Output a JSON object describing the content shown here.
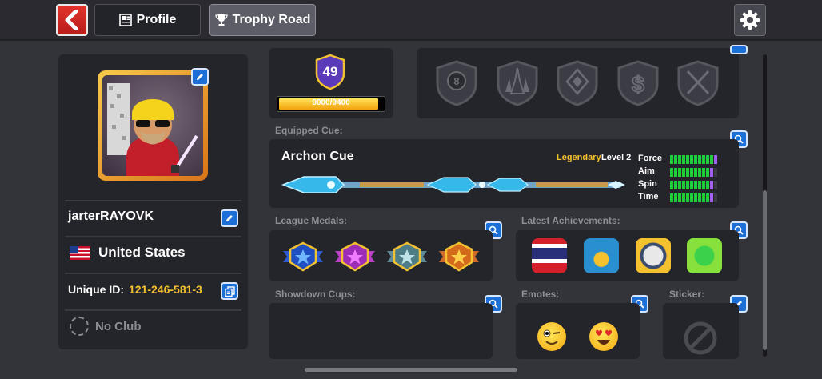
{
  "header": {
    "tabs": [
      {
        "label": "Profile"
      },
      {
        "label": "Trophy Road"
      }
    ]
  },
  "profile": {
    "username": "jarterRAYOVK",
    "country": "United States",
    "unique_id_label": "Unique ID:",
    "unique_id": "121-246-581-3",
    "club": "No Club"
  },
  "level": {
    "value": "49",
    "xp_text": "9000/9400",
    "xp_fraction": 0.957
  },
  "trophy_badges": [
    "8-ball-shield-icon",
    "tower-shield-icon",
    "diamond-shield-icon",
    "dollar-shield-icon",
    "swords-shield-icon"
  ],
  "equipped_cue": {
    "section_label": "Equipped Cue:",
    "name": "Archon Cue",
    "rarity": "Legendary",
    "level": "Level 2",
    "stats": [
      {
        "label": "Force",
        "filled": 11,
        "purple": 1,
        "empty": 0
      },
      {
        "label": "Aim",
        "filled": 10,
        "purple": 1,
        "empty": 1
      },
      {
        "label": "Spin",
        "filled": 10,
        "purple": 1,
        "empty": 1
      },
      {
        "label": "Time",
        "filled": 10,
        "purple": 1,
        "empty": 1
      }
    ]
  },
  "sections": {
    "league_medals": "League Medals:",
    "latest_achievements": "Latest Achievements:",
    "showdown_cups": "Showdown Cups:",
    "emotes": "Emotes:",
    "sticker": "Sticker:"
  },
  "colors": {
    "accent_blue": "#1b6fd6",
    "gold_text": "#f5c12e",
    "stat_green": "#1fcf3a",
    "stat_purple": "#a35ff0",
    "back_red": "#d42a25"
  }
}
